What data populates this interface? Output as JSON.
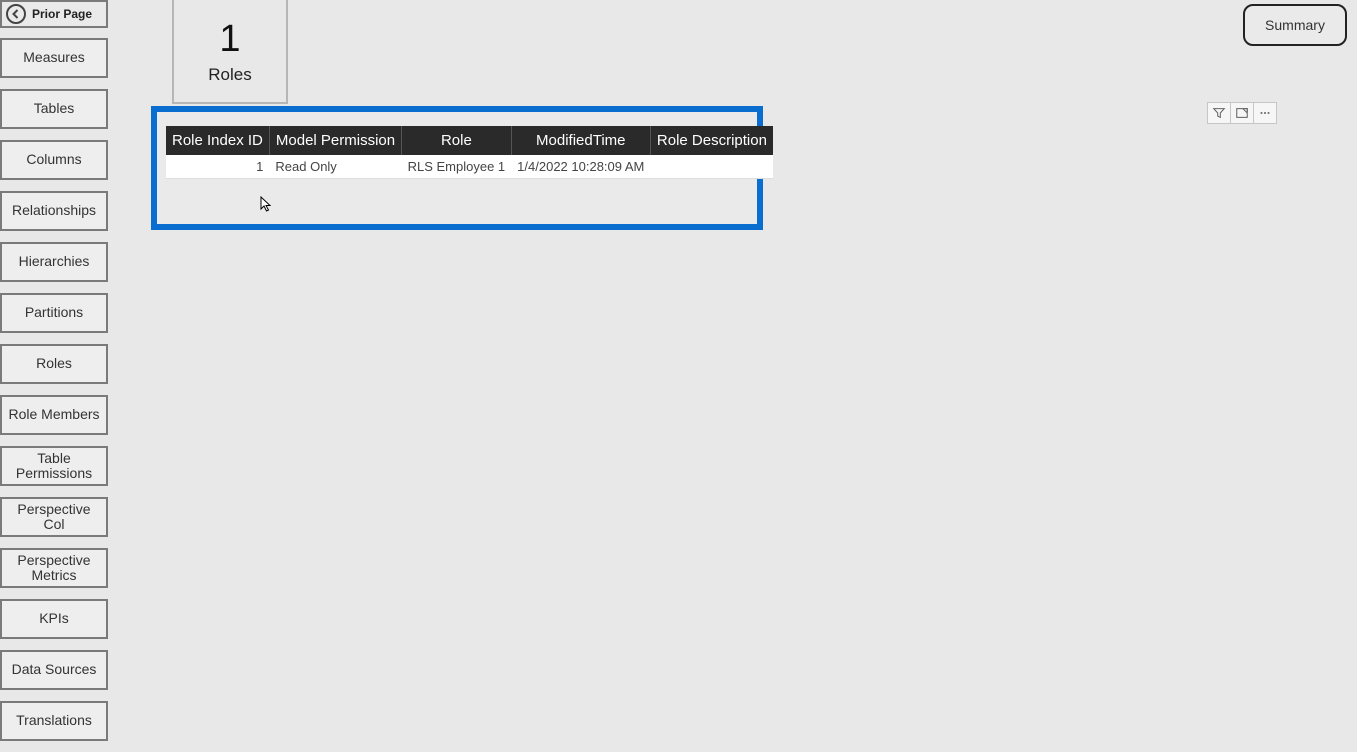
{
  "sidebar": {
    "prior_page": "Prior Page",
    "items": [
      "Measures",
      "Tables",
      "Columns",
      "Relationships",
      "Hierarchies",
      "Partitions",
      "Roles",
      "Role Members",
      "Table Permissions",
      "Perspective Col",
      "Perspective Metrics",
      "KPIs",
      "Data Sources",
      "Translations"
    ]
  },
  "card": {
    "value": "1",
    "label": "Roles"
  },
  "summary_button": "Summary",
  "toolbar": {
    "filter": "filter",
    "focus": "focus-mode",
    "more": "more-options"
  },
  "table": {
    "headers": [
      "Role Index ID",
      "Model Permission",
      "Role",
      "ModifiedTime",
      "Role Description"
    ],
    "rows": [
      {
        "role_index_id": "1",
        "model_permission": "Read Only",
        "role": "RLS Employee 1",
        "modified_time": "1/4/2022 10:28:09 AM",
        "role_description": ""
      }
    ]
  },
  "colors": {
    "highlight_border": "#0a6ed1",
    "table_header_bg": "#2a2a2a"
  }
}
